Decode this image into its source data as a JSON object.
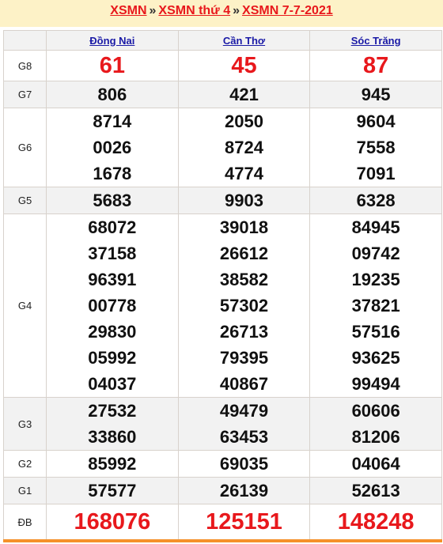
{
  "breadcrumb": {
    "items": [
      "XSMN",
      "XSMN thứ 4",
      "XSMN 7-7-2021"
    ],
    "separator": "»"
  },
  "table": {
    "provinces": [
      "Đồng Nai",
      "Cần Thơ",
      "Sóc Trăng"
    ],
    "rows": [
      {
        "label": "G8",
        "values": [
          [
            "61"
          ],
          [
            "45"
          ],
          [
            "87"
          ]
        ],
        "style": "big"
      },
      {
        "label": "G7",
        "values": [
          [
            "806"
          ],
          [
            "421"
          ],
          [
            "945"
          ]
        ],
        "style": "num"
      },
      {
        "label": "G6",
        "values": [
          [
            "8714",
            "0026",
            "1678"
          ],
          [
            "2050",
            "8724",
            "4774"
          ],
          [
            "9604",
            "7558",
            "7091"
          ]
        ],
        "style": "num"
      },
      {
        "label": "G5",
        "values": [
          [
            "5683"
          ],
          [
            "9903"
          ],
          [
            "6328"
          ]
        ],
        "style": "num"
      },
      {
        "label": "G4",
        "values": [
          [
            "68072",
            "37158",
            "96391",
            "00778",
            "29830",
            "05992",
            "04037"
          ],
          [
            "39018",
            "26612",
            "38582",
            "57302",
            "26713",
            "79395",
            "40867"
          ],
          [
            "84945",
            "09742",
            "19235",
            "37821",
            "57516",
            "93625",
            "99494"
          ]
        ],
        "style": "num"
      },
      {
        "label": "G3",
        "values": [
          [
            "27532",
            "33860"
          ],
          [
            "49479",
            "63453"
          ],
          [
            "60606",
            "81206"
          ]
        ],
        "style": "num"
      },
      {
        "label": "G2",
        "values": [
          [
            "85992"
          ],
          [
            "69035"
          ],
          [
            "04064"
          ]
        ],
        "style": "num"
      },
      {
        "label": "G1",
        "values": [
          [
            "57577"
          ],
          [
            "26139"
          ],
          [
            "52613"
          ]
        ],
        "style": "num"
      },
      {
        "label": "ĐB",
        "values": [
          [
            "168076"
          ],
          [
            "125151"
          ],
          [
            "148248"
          ]
        ],
        "style": "db"
      }
    ]
  },
  "colors": {
    "accent_red": "#e8181c",
    "link_blue": "#1a1aa6",
    "banner_bg": "#fdf2c7",
    "bottom_border": "#f5912a"
  }
}
